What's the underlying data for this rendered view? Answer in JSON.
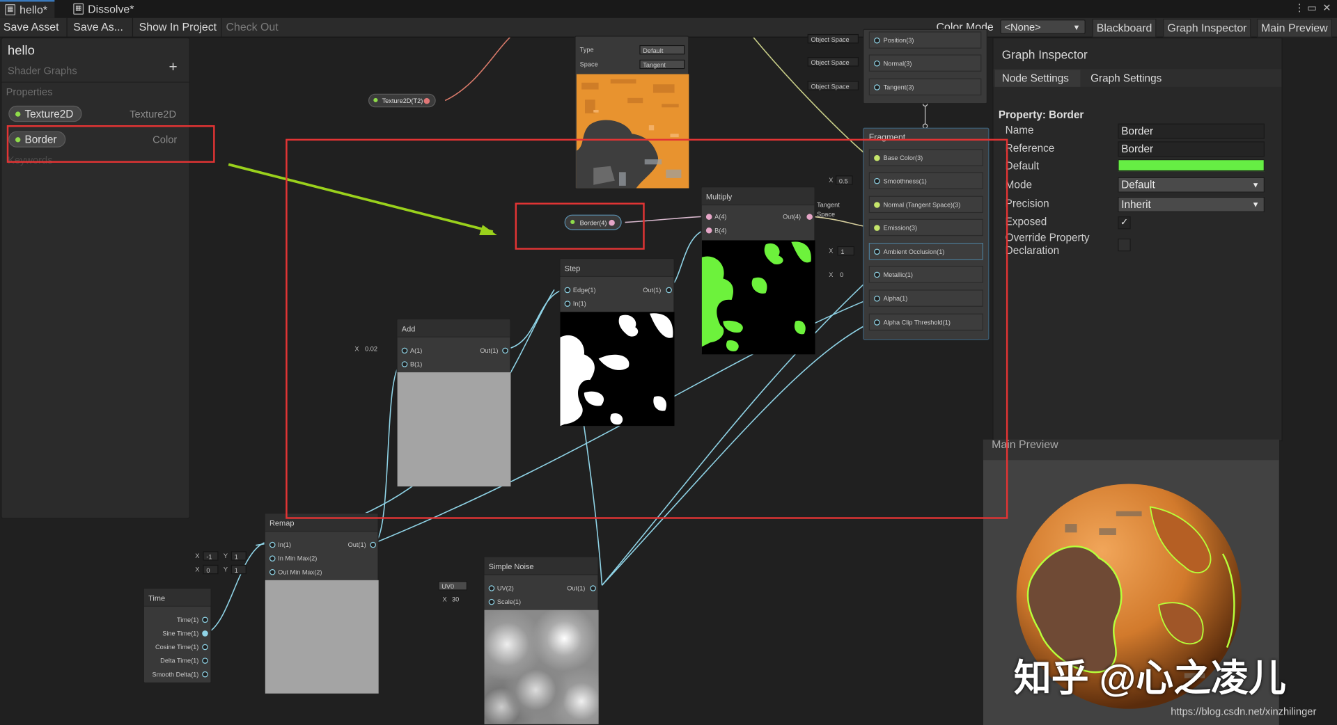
{
  "tabs": [
    {
      "label": "hello*",
      "active": true
    },
    {
      "label": "Dissolve*",
      "active": false
    }
  ],
  "toolbar": {
    "save_asset": "Save Asset",
    "save_as": "Save As...",
    "show_in_project": "Show In Project",
    "check_out": "Check Out",
    "color_mode_label": "Color Mode",
    "color_mode_value": "<None>",
    "blackboard": "Blackboard",
    "graph_inspector": "Graph Inspector",
    "main_preview": "Main Preview"
  },
  "blackboard": {
    "title": "hello",
    "subtitle": "Shader Graphs",
    "add": "+",
    "section_properties": "Properties",
    "properties": [
      {
        "name": "Texture2D",
        "type": "Texture2D"
      },
      {
        "name": "Border",
        "type": "Color"
      }
    ],
    "section_keywords": "Keywords"
  },
  "nodes": {
    "texture_prop": "Texture2D(T2)",
    "border_prop": "Border(4)",
    "sample": {
      "type_label": "Type",
      "type_value": "Default",
      "space_label": "Space",
      "space_value": "Tangent"
    },
    "vertex_ports": [
      {
        "space": "Object Space",
        "label": "Position(3)"
      },
      {
        "space": "Object Space",
        "label": "Normal(3)"
      },
      {
        "space": "Object Space",
        "label": "Tangent(3)"
      }
    ],
    "fragment": {
      "title": "Fragment",
      "ports": [
        "Base Color(3)",
        "Smoothness(1)",
        "Normal (Tangent Space)(3)",
        "Emission(3)",
        "Ambient Occlusion(1)",
        "Metallic(1)",
        "Alpha(1)",
        "Alpha Clip Threshold(1)"
      ],
      "smoothness_value": "0.5",
      "normal_space": "Tangent Space",
      "ao_value": "1",
      "metallic_value": "0"
    },
    "multiply": {
      "title": "Multiply",
      "in_a": "A(4)",
      "in_b": "B(4)",
      "out": "Out(4)"
    },
    "step": {
      "title": "Step",
      "in_edge": "Edge(1)",
      "in_in": "In(1)",
      "out": "Out(1)"
    },
    "add": {
      "title": "Add",
      "in_a": "A(1)",
      "in_b": "B(1)",
      "out": "Out(1)",
      "a_value": "0.02"
    },
    "remap": {
      "title": "Remap",
      "in": "In(1)",
      "in_min_max": "In Min Max(2)",
      "out_min_max": "Out Min Max(2)",
      "out": "Out(1)",
      "in_x": "-1",
      "in_y": "1",
      "out_x": "0",
      "out_y": "1"
    },
    "time": {
      "title": "Time",
      "ports": [
        "Time(1)",
        "Sine Time(1)",
        "Cosine Time(1)",
        "Delta Time(1)",
        "Smooth Delta(1)"
      ]
    },
    "noise": {
      "title": "Simple Noise",
      "in_uv": "UV(2)",
      "in_scale": "Scale(1)",
      "out": "Out(1)",
      "uv_value": "UV0",
      "scale_value": "30"
    }
  },
  "axis_labels": {
    "x": "X",
    "y": "Y"
  },
  "inspector": {
    "title": "Graph Inspector",
    "tab_node": "Node Settings",
    "tab_graph": "Graph Settings",
    "property_heading": "Property: Border",
    "name_label": "Name",
    "name_value": "Border",
    "reference_label": "Reference",
    "reference_value": "Border",
    "default_label": "Default",
    "default_color": "#66ee44",
    "mode_label": "Mode",
    "mode_value": "Default",
    "precision_label": "Precision",
    "precision_value": "Inherit",
    "exposed_label": "Exposed",
    "override_label_1": "Override Property",
    "override_label_2": "Declaration"
  },
  "preview": {
    "title": "Main Preview"
  },
  "watermark": {
    "text": "知乎 @心之凌儿",
    "url": "https://blog.csdn.net/xinzhilinger"
  },
  "colors": {
    "highlight": "#e23434",
    "arrow": "#9ad11c",
    "accent_green": "#66ee44",
    "orange": "#e58a2e"
  }
}
